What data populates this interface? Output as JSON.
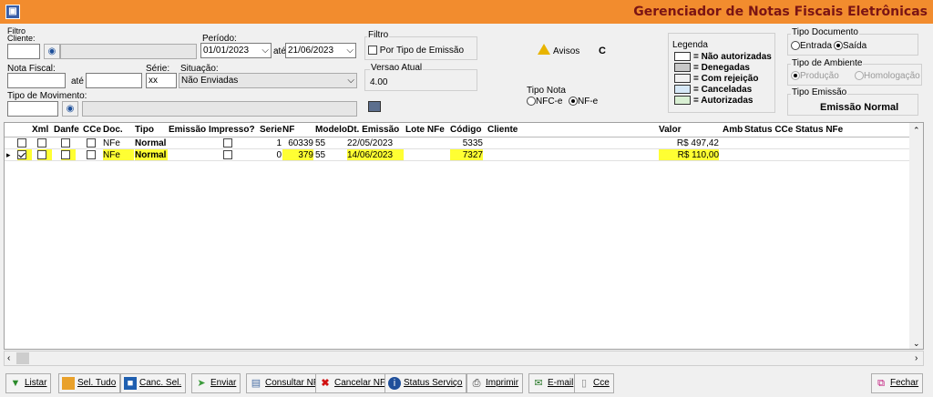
{
  "app": {
    "title": "Gerenciador de Notas Fiscais Eletrônicas",
    "icon_glyph": "▣"
  },
  "filters": {
    "filtro_label": "Filtro",
    "cliente_label": "Cliente:",
    "cliente_code": "",
    "cliente_name": "",
    "periodo_label": "Período:",
    "periodo_start": "01/01/2023",
    "ate_label": "até",
    "periodo_end": "21/06/2023",
    "nota_fiscal_label": "Nota Fiscal:",
    "nf_start": "",
    "nf_ate_label": "até",
    "nf_end": "",
    "serie_label": "Série:",
    "serie_value": "xx",
    "situacao_label": "Situação:",
    "situacao_value": "Não Enviadas",
    "tipo_mov_label": "Tipo de Movimento:",
    "tipo_mov_code": "",
    "tipo_mov_name": ""
  },
  "filtro_group": {
    "title": "Filtro",
    "por_tipo_emissao": "Por Tipo de Emissão"
  },
  "versao": {
    "title": "Versao Atual",
    "value": "4.00"
  },
  "avisos": {
    "label": "Avisos",
    "value": "C"
  },
  "tipo_nota": {
    "title": "Tipo Nota",
    "opt1": "NFC-e",
    "opt2": "NF-e",
    "selected": "NF-e"
  },
  "legenda": {
    "title": "Legenda",
    "items": [
      {
        "label": "= Não autorizadas",
        "color": "#ffffff"
      },
      {
        "label": "= Denegadas",
        "color": "#c8c8c8"
      },
      {
        "label": "= Com rejeição",
        "color": "#f0f0f0"
      },
      {
        "label": "= Canceladas",
        "color": "#d6e8f7"
      },
      {
        "label": "= Autorizadas",
        "color": "#d9efd3"
      }
    ]
  },
  "tipo_documento": {
    "title": "Tipo Documento",
    "opt1": "Entrada",
    "opt2": "Saída",
    "selected": "Saída"
  },
  "tipo_ambiente": {
    "title": "Tipo de Ambiente",
    "opt1": "Produção",
    "opt2": "Homologação"
  },
  "tipo_emissao": {
    "title": "Tipo Emissão",
    "value": "Emissão Normal"
  },
  "grid": {
    "headers": [
      "Xml",
      "Danfe",
      "CCe",
      "Doc.",
      "Tipo",
      "Emissão",
      "Impresso?",
      "Serie",
      "NF",
      "Modelo",
      "Dt. Emissão",
      "Lote NFe",
      "Código",
      "Cliente",
      "Valor",
      "Amb",
      "Status CCe",
      "Status NFe"
    ],
    "rows": [
      {
        "doc": "NFe",
        "tipo": "Normal",
        "serie": "1",
        "nf": "60339",
        "modelo": "55",
        "dt": "22/05/2023",
        "codigo": "5335",
        "valor": "R$ 497,42",
        "xml": false,
        "selected": false
      },
      {
        "doc": "NFe",
        "tipo": "Normal",
        "serie": "0",
        "nf": "379",
        "modelo": "55",
        "dt": "14/06/2023",
        "codigo": "7327",
        "valor": "R$ 110,00",
        "xml": true,
        "selected": true
      }
    ]
  },
  "toolbar": {
    "listar": "Listar",
    "sel_tudo": "Sel. Tudo",
    "canc_sel": "Canc. Sel.",
    "enviar": "Enviar",
    "consultar": "Consultar NF",
    "cancelar": "Cancelar NF",
    "status": "Status Serviço",
    "imprimir": "Imprimir",
    "email": "E-mail",
    "cce": "Cce",
    "fechar": "Fechar"
  },
  "colors": {
    "titlebar": "#f28c2e",
    "title_text": "#7a1414",
    "highlight": "#ffff33"
  }
}
